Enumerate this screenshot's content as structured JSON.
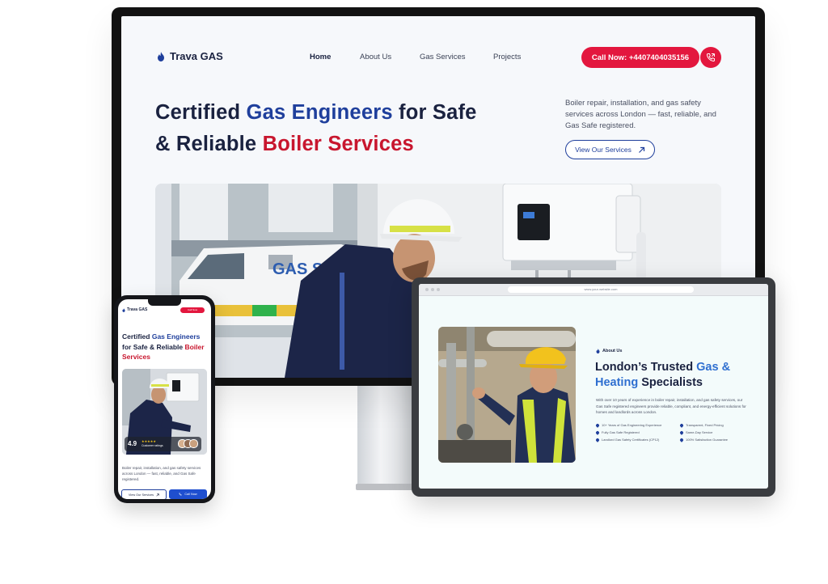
{
  "desktop": {
    "logo": "Trava GAS",
    "nav": [
      "Home",
      "About Us",
      "Gas Services",
      "Projects"
    ],
    "call_label": "Call Now: +4407404035156",
    "hero": {
      "line1_a": "Certified ",
      "line1_b": "Gas Engineers",
      "line1_c": " for Safe",
      "line2_a": "& Reliable ",
      "line2_b": "Boiler Services"
    },
    "description": "Boiler repair, installation, and gas safety services across London — fast, reliable, and Gas Safe registered.",
    "services_button": "View Our Services",
    "van_text": "GAS S"
  },
  "tablet": {
    "url": "www.your-website.com",
    "section_label": "About Us",
    "title_a": "London’s Trusted ",
    "title_b": "Gas &",
    "title_c": "Heating",
    "title_d": " Specialists",
    "description": "With over 10 years of experience in boiler repair, installation, and gas safety services, our Gas Safe registered engineers provide reliable, compliant, and energy-efficient solutions for homes and landlords across London.",
    "features": [
      "10+ Years of Gas Engineering Experience",
      "Transparent, Fixed Pricing",
      "Fully Gas Safe Registered",
      "Same-Day Service",
      "Landlord Gas Safety Certificates (CP12)",
      "100% Satisfaction Guarantee"
    ]
  },
  "phone": {
    "logo": "Trava GAS",
    "call_label": "Call Now",
    "title_a": "Certified ",
    "title_b": "Gas Engineers",
    "title_c": "for Safe & Reliable ",
    "title_d": "Boiler",
    "title_e": "Services",
    "rating_value": "4.9",
    "rating_stars": "★★★★★",
    "rating_label": "Customer ratings",
    "description": "Boiler repair, installation, and gas safety services across London — fast, reliable, and Gas Safe registered.",
    "btn_services": "View Our Services",
    "btn_call": "Call Now"
  },
  "colors": {
    "navy": "#1a2240",
    "blue": "#1f3f9c",
    "red": "#e3173e"
  }
}
